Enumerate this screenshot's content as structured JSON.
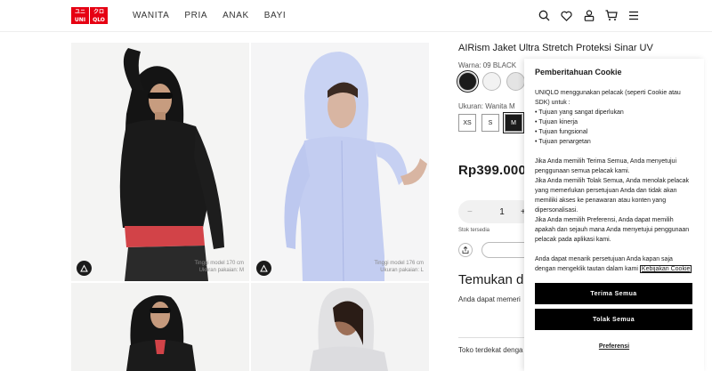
{
  "header": {
    "logo_top": "ユニ",
    "logo_top2": "クロ",
    "logo_bottom": "UNI",
    "logo_bottom2": "QLO",
    "nav": [
      "WANITA",
      "PRIA",
      "ANAK",
      "BAYI"
    ],
    "icons": [
      "search-icon",
      "heart-icon",
      "user-icon",
      "cart-icon",
      "menu-icon"
    ]
  },
  "gallery": {
    "captions": [
      {
        "line1": "Tinggi model 170 cm",
        "line2": "Ukuran pakaian: M"
      },
      {
        "line1": "Tinggi model 176 cm",
        "line2": "Ukuran pakaian: L"
      }
    ]
  },
  "product": {
    "title": "AIRism Jaket Ultra Stretch Proteksi Sinar UV",
    "color_label": "Warna: 09 BLACK",
    "swatches": [
      "#1b1b1b",
      "#f2f2f2",
      "#e4e4e4"
    ],
    "size_label": "Ukuran: Wanita M",
    "sizes": [
      "XS",
      "S",
      "M"
    ],
    "selected_size": "M",
    "price": "Rp399.000",
    "qty_minus": "−",
    "qty_value": "1",
    "qty_plus": "+",
    "stock": "Stok tersedia",
    "find_title": "Temukan di",
    "find_sub": "Anda dapat memeri",
    "store_label": "Toko terdekat denga"
  },
  "cookie": {
    "title": "Pemberitahuan Cookie",
    "p1": "UNIQLO menggunakan pelacak (seperti Cookie atau SDK) untuk :",
    "bullets": [
      "• Tujuan yang sangat diperlukan",
      "• Tujuan kinerja",
      "• Tujuan fungsional",
      "• Tujuan penargetan"
    ],
    "p2": "Jika Anda memilih Terima Semua, Anda menyetujui penggunaan semua pelacak kami.",
    "p3": "Jika Anda memilih Tolak Semua, Anda menolak pelacak yang memerlukan persetujuan Anda dan tidak akan memiliki akses ke penawaran atau konten yang dipersonalisasi.",
    "p4": "Jika Anda memilih Preferensi, Anda dapat memilih apakah dan sejauh mana Anda menyetujui penggunaan pelacak pada aplikasi kami.",
    "p5": "Anda dapat menarik persetujuan Anda kapan saja dengan mengeklik tautan dalam kami",
    "link": "Kebijakan Cookie",
    "accept": "Terima Semua",
    "reject": "Tolak Semua",
    "prefs": "Preferensi"
  },
  "colors": {
    "brand": "#e60012",
    "button": "#000000"
  }
}
